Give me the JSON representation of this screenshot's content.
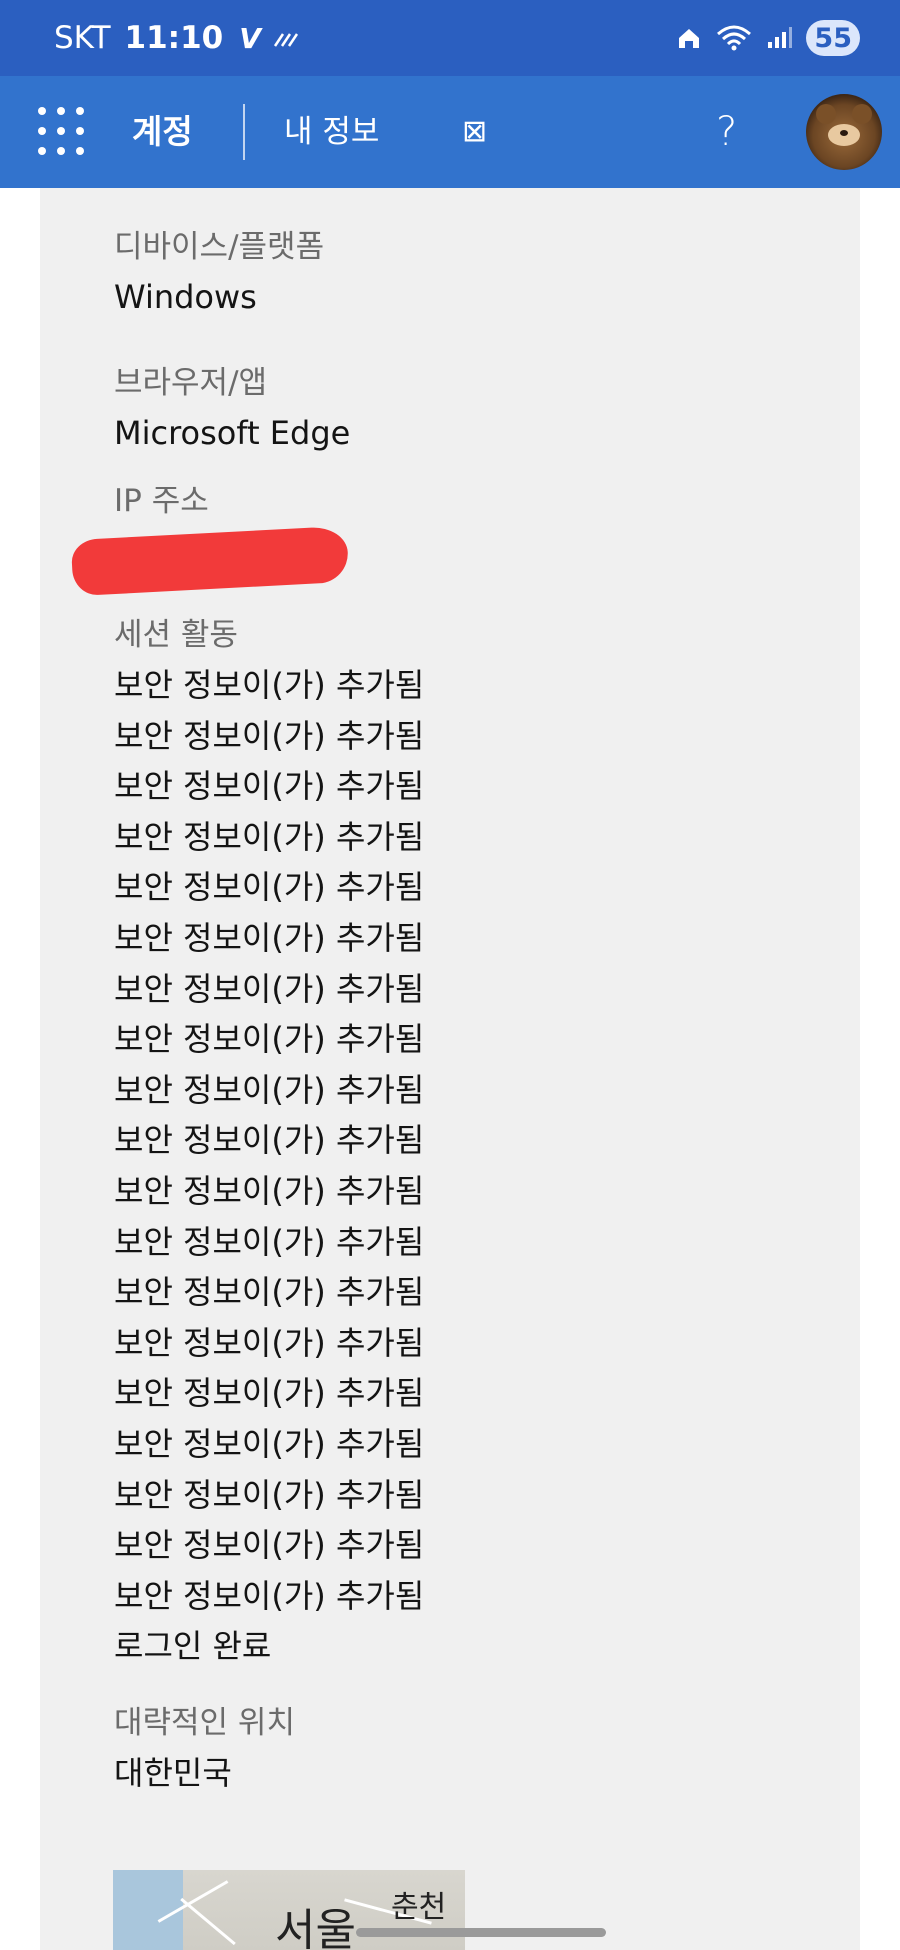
{
  "status_bar": {
    "carrier": "SKT",
    "time": "11:10",
    "battery": "55"
  },
  "header": {
    "title": "계정",
    "subtitle": "내 정보",
    "box_glyph": "⊠",
    "help": "?"
  },
  "details": {
    "device_label": "디바이스/플랫폼",
    "device_value": "Windows",
    "browser_label": "브라우저/앱",
    "browser_value": "Microsoft Edge",
    "ip_label": "IP 주소",
    "session_label": "세션 활동",
    "session_items": [
      "보안 정보이(가) 추가됨",
      "보안 정보이(가) 추가됨",
      "보안 정보이(가) 추가됨",
      "보안 정보이(가) 추가됨",
      "보안 정보이(가) 추가됨",
      "보안 정보이(가) 추가됨",
      "보안 정보이(가) 추가됨",
      "보안 정보이(가) 추가됨",
      "보안 정보이(가) 추가됨",
      "보안 정보이(가) 추가됨",
      "보안 정보이(가) 추가됨",
      "보안 정보이(가) 추가됨",
      "보안 정보이(가) 추가됨",
      "보안 정보이(가) 추가됨",
      "보안 정보이(가) 추가됨",
      "보안 정보이(가) 추가됨",
      "보안 정보이(가) 추가됨",
      "보안 정보이(가) 추가됨",
      "보안 정보이(가) 추가됨",
      "로그인 완료"
    ],
    "location_label": "대략적인 위치",
    "location_value": "대한민국"
  },
  "map": {
    "label_seoul": "서울",
    "label_chuncheon": "춘천"
  },
  "colors": {
    "status_bar": "#2b5fc0",
    "header": "#3273cd",
    "panel": "#f0f0f0",
    "redaction": "#f23a3a"
  },
  "icons": {
    "app_launcher": "waffle-icon",
    "help": "help-icon",
    "avatar": "avatar-icon"
  }
}
